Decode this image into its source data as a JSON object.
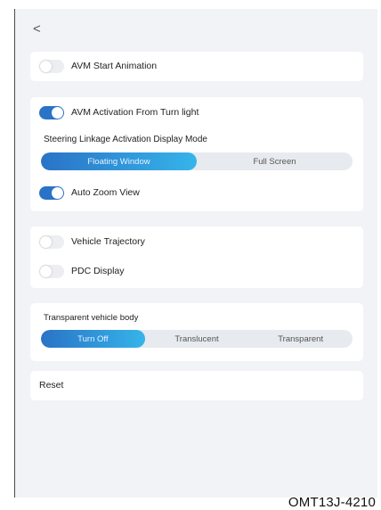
{
  "header": {
    "back_glyph": "<"
  },
  "card_avm": {
    "start_animation": {
      "label": "AVM Start Animation",
      "enabled": false
    }
  },
  "card_activation": {
    "turn_light": {
      "label": "AVM Activation From Turn light",
      "enabled": true
    },
    "steering_mode": {
      "label": "Steering Linkage Activation Display Mode",
      "options": [
        "Floating Window",
        "Full Screen"
      ],
      "selected": "Floating Window"
    },
    "auto_zoom": {
      "label": "Auto Zoom View",
      "enabled": true
    }
  },
  "card_trajectory": {
    "vehicle_trajectory": {
      "label": "Vehicle Trajectory",
      "enabled": false
    },
    "pdc_display": {
      "label": "PDC Display",
      "enabled": false
    }
  },
  "card_transparent": {
    "label": "Transparent vehicle body",
    "options": [
      "Turn Off",
      "Translucent",
      "Transparent"
    ],
    "selected": "Turn Off"
  },
  "card_reset": {
    "label": "Reset"
  },
  "footer": {
    "code": "OMT13J-4210"
  },
  "colors": {
    "accent": "#2a73c6",
    "accent_light": "#36b4ea",
    "background": "#f1f3f6"
  }
}
